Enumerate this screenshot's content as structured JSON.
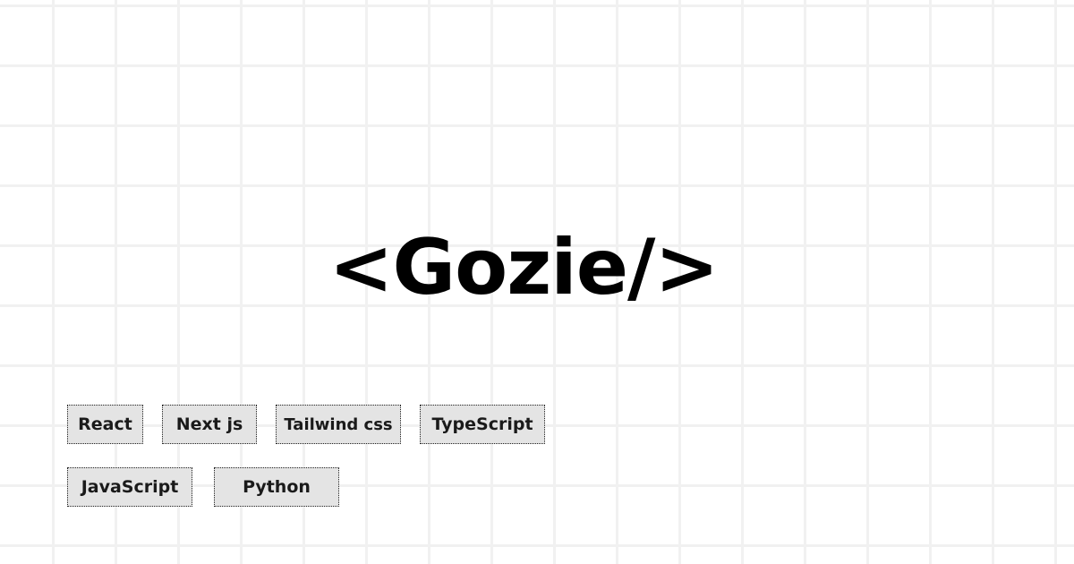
{
  "brand": {
    "logo_text": "<Gozie/>"
  },
  "tags": [
    {
      "label": "React"
    },
    {
      "label": "Next js"
    },
    {
      "label": "Tailwind css"
    },
    {
      "label": "TypeScript"
    },
    {
      "label": "JavaScript"
    },
    {
      "label": "Python"
    }
  ],
  "colors": {
    "background": "#ffffff",
    "grid_line": "#f1f1f1",
    "tag_fill": "#e4e4e4",
    "tag_border": "#222222",
    "text": "#000000"
  }
}
